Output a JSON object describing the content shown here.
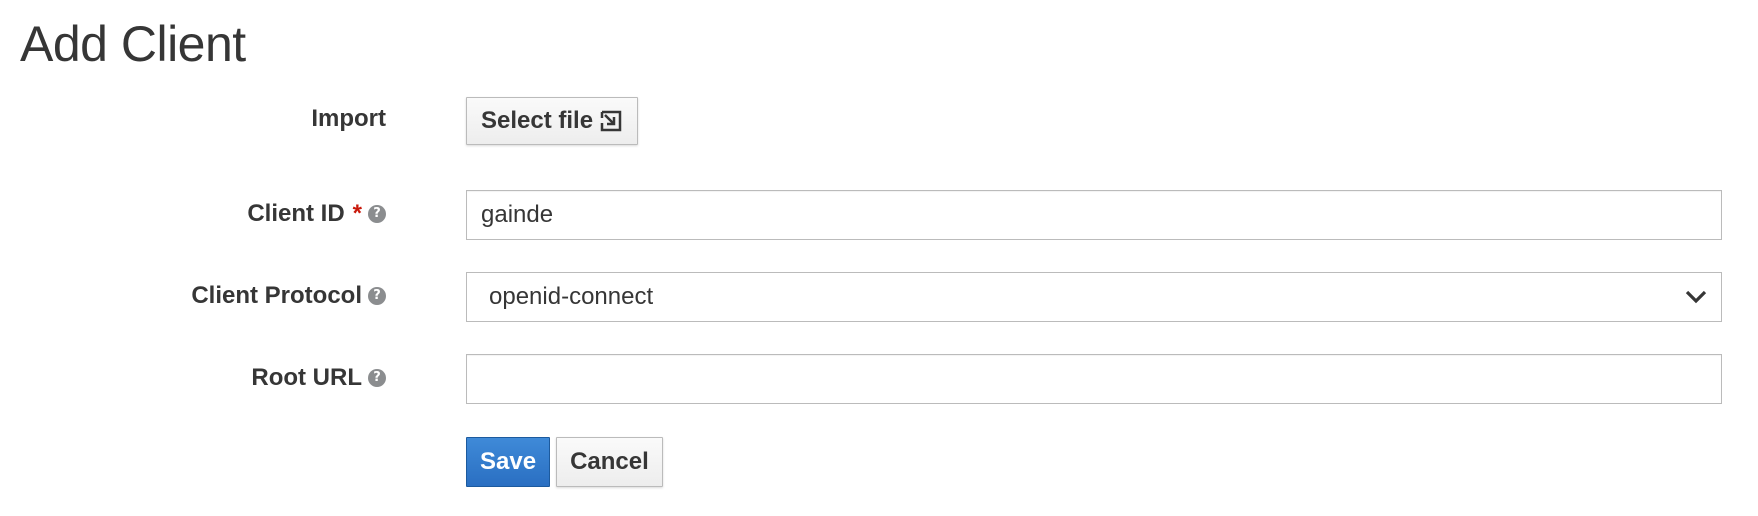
{
  "page": {
    "title": "Add Client"
  },
  "form": {
    "import": {
      "label": "Import",
      "button_label": "Select file",
      "button_icon": "file-import-icon"
    },
    "client_id": {
      "label": "Client ID",
      "required_marker": "*",
      "help_icon": "question-circle-icon",
      "value": "gainde"
    },
    "client_protocol": {
      "label": "Client Protocol",
      "help_icon": "question-circle-icon",
      "selected": "openid-connect"
    },
    "root_url": {
      "label": "Root URL",
      "help_icon": "question-circle-icon",
      "value": ""
    }
  },
  "actions": {
    "save_label": "Save",
    "cancel_label": "Cancel"
  },
  "colors": {
    "primary": "#2a6fc2",
    "required": "#c9190b",
    "text": "#363636"
  }
}
